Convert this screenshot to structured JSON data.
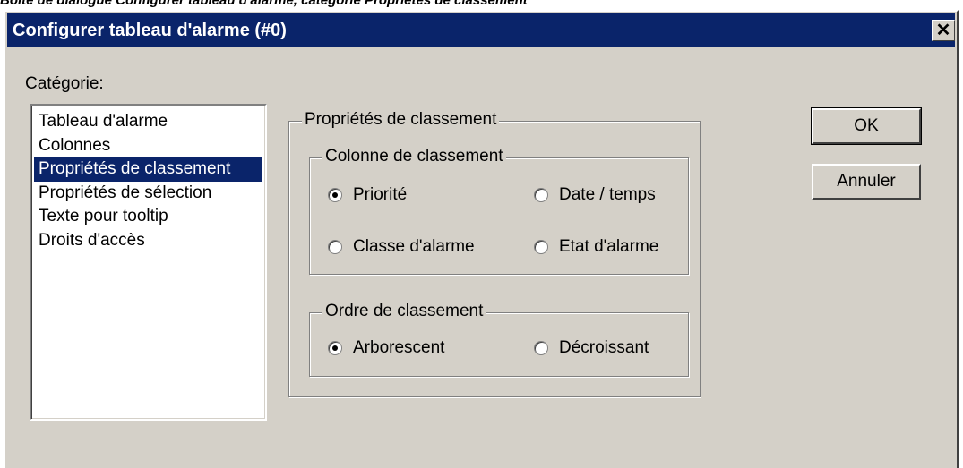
{
  "caption": "Boîte de dialogue Configurer tableau d'alarme, catégorie Propriétés de classement",
  "window": {
    "title": "Configurer tableau d'alarme (#0)",
    "close_glyph": "✕"
  },
  "category": {
    "label": "Catégorie:",
    "items": [
      {
        "label": "Tableau d'alarme",
        "selected": false
      },
      {
        "label": "Colonnes",
        "selected": false
      },
      {
        "label": "Propriétés de classement",
        "selected": true
      },
      {
        "label": "Propriétés de sélection",
        "selected": false
      },
      {
        "label": "Texte pour tooltip",
        "selected": false
      },
      {
        "label": "Droits d'accès",
        "selected": false
      }
    ]
  },
  "sort_properties": {
    "title": "Propriétés de classement",
    "column_group": {
      "title": "Colonne de classement",
      "options": [
        {
          "label": "Priorité",
          "checked": true
        },
        {
          "label": "Date / temps",
          "checked": false
        },
        {
          "label": "Classe d'alarme",
          "checked": false
        },
        {
          "label": "Etat d'alarme",
          "checked": false
        }
      ]
    },
    "order_group": {
      "title": "Ordre de classement",
      "options": [
        {
          "label": "Arborescent",
          "checked": true
        },
        {
          "label": "Décroissant",
          "checked": false
        }
      ]
    }
  },
  "buttons": {
    "ok": "OK",
    "cancel": "Annuler"
  },
  "colors": {
    "titlebar": "#0a246a",
    "face": "#d4d0c8",
    "selection": "#0a246a"
  }
}
